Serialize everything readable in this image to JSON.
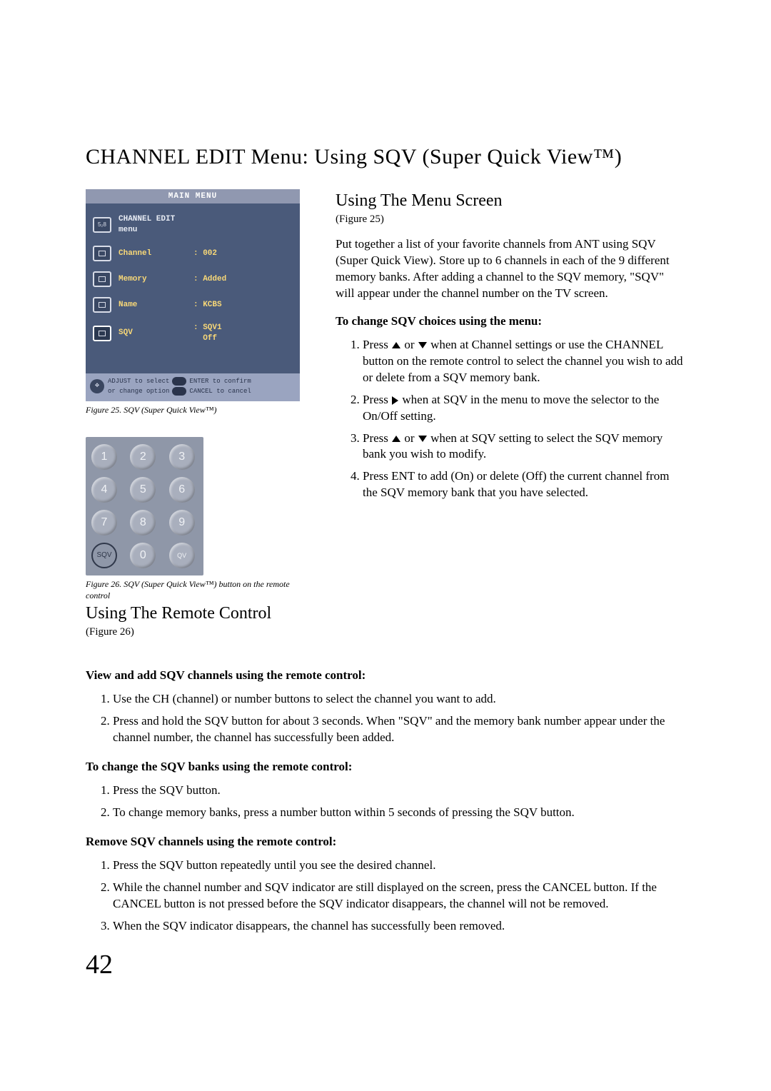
{
  "title": "CHANNEL EDIT Menu: Using SQV (Super Quick View™)",
  "osd": {
    "header": "MAIN MENU",
    "section_label": "CHANNEL EDIT menu",
    "rows": [
      {
        "label": "Channel",
        "value": ": 002"
      },
      {
        "label": "Memory",
        "value": ": Added"
      },
      {
        "label": "Name",
        "value": ": KCBS"
      },
      {
        "label": "SQV",
        "value": ": SQV1\n  Off"
      }
    ],
    "footer_adjust": "ADJUST to select",
    "footer_enter": "ENTER to confirm",
    "footer_change": "or change option",
    "footer_cancel": "CANCEL to cancel"
  },
  "fig25_caption": "Figure 25. SQV (Super Quick View™)",
  "numpad": {
    "keys": [
      "1",
      "2",
      "3",
      "4",
      "5",
      "6",
      "7",
      "8",
      "9",
      "SQV",
      "0",
      "QV"
    ]
  },
  "fig26_caption": "Figure 26. SQV (Super Quick View™) button on the remote control",
  "section_remote_title": "Using The Remote Control",
  "section_remote_figref": "(Figure 26)",
  "section_menu_title": "Using The Menu Screen",
  "section_menu_figref": "(Figure 25)",
  "menu_intro": "Put together a list of your favorite channels from ANT using SQV (Super Quick View). Store up to 6 channels in each of the 9 different memory banks. After adding a channel to the SQV memory, \"SQV\" will appear under the channel number on the TV screen.",
  "menu_change_heading": "To change SQV choices using the menu:",
  "menu_steps": {
    "s1a": "Press ",
    "s1b": " or ",
    "s1c": " when at Channel settings or use the CHANNEL button on the remote control to select the channel you wish to add or delete from a SQV memory bank.",
    "s2a": "Press ",
    "s2b": " when at SQV in the menu to move the selector to the On/Off setting.",
    "s3a": "Press ",
    "s3b": " or ",
    "s3c": " when at SQV setting to select the SQV memory bank you wish to modify.",
    "s4": "Press ENT to add (On) or delete (Off) the current channel from the SQV memory bank that you have selected."
  },
  "remote_view_heading": "View and add SQV channels using the remote control:",
  "remote_view_steps": [
    "Use the CH (channel) or number buttons to select the channel you want to add.",
    "Press and hold the SQV button for about 3 seconds. When \"SQV\" and the memory bank number appear under the channel number, the channel has successfully been added."
  ],
  "remote_change_heading": "To change the SQV banks using the remote control:",
  "remote_change_steps": [
    "Press the SQV button.",
    "To change memory banks, press a number button within 5 seconds of pressing the SQV button."
  ],
  "remote_remove_heading": "Remove SQV channels using the remote control:",
  "remote_remove_steps": [
    "Press the SQV button repeatedly until you see the desired channel.",
    "While the channel number and SQV indicator are still displayed on the screen, press the CANCEL button. If the CANCEL button is not pressed before the SQV indicator disappears, the channel will not be removed.",
    "When the SQV indicator disappears, the channel has successfully been removed."
  ],
  "page_number": "42"
}
